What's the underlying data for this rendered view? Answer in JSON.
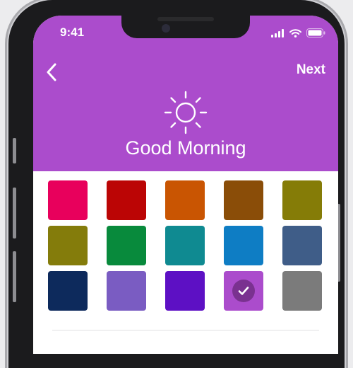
{
  "status_bar": {
    "time": "9:41"
  },
  "nav": {
    "back_icon": "chevron-left-icon",
    "next_label": "Next"
  },
  "header": {
    "icon": "sun-icon",
    "title": "Good Morning",
    "background": "#ab4ccc"
  },
  "colors": [
    {
      "name": "pink-red",
      "hex": "#e8005c",
      "selected": false
    },
    {
      "name": "red",
      "hex": "#bb0505",
      "selected": false
    },
    {
      "name": "orange",
      "hex": "#c95502",
      "selected": false
    },
    {
      "name": "brown",
      "hex": "#8a4d08",
      "selected": false
    },
    {
      "name": "olive",
      "hex": "#857c07",
      "selected": false
    },
    {
      "name": "dark-olive",
      "hex": "#847c0b",
      "selected": false
    },
    {
      "name": "green",
      "hex": "#088a3c",
      "selected": false
    },
    {
      "name": "teal",
      "hex": "#0f8a91",
      "selected": false
    },
    {
      "name": "blue",
      "hex": "#0e7dc4",
      "selected": false
    },
    {
      "name": "steel-blue",
      "hex": "#3f5d88",
      "selected": false
    },
    {
      "name": "navy",
      "hex": "#0d2a5c",
      "selected": false
    },
    {
      "name": "lavender-purple",
      "hex": "#7a5cc2",
      "selected": false
    },
    {
      "name": "violet",
      "hex": "#5d10c4",
      "selected": false
    },
    {
      "name": "purple",
      "hex": "#ab4ccc",
      "selected": true
    },
    {
      "name": "gray",
      "hex": "#7b7b7b",
      "selected": false
    }
  ]
}
